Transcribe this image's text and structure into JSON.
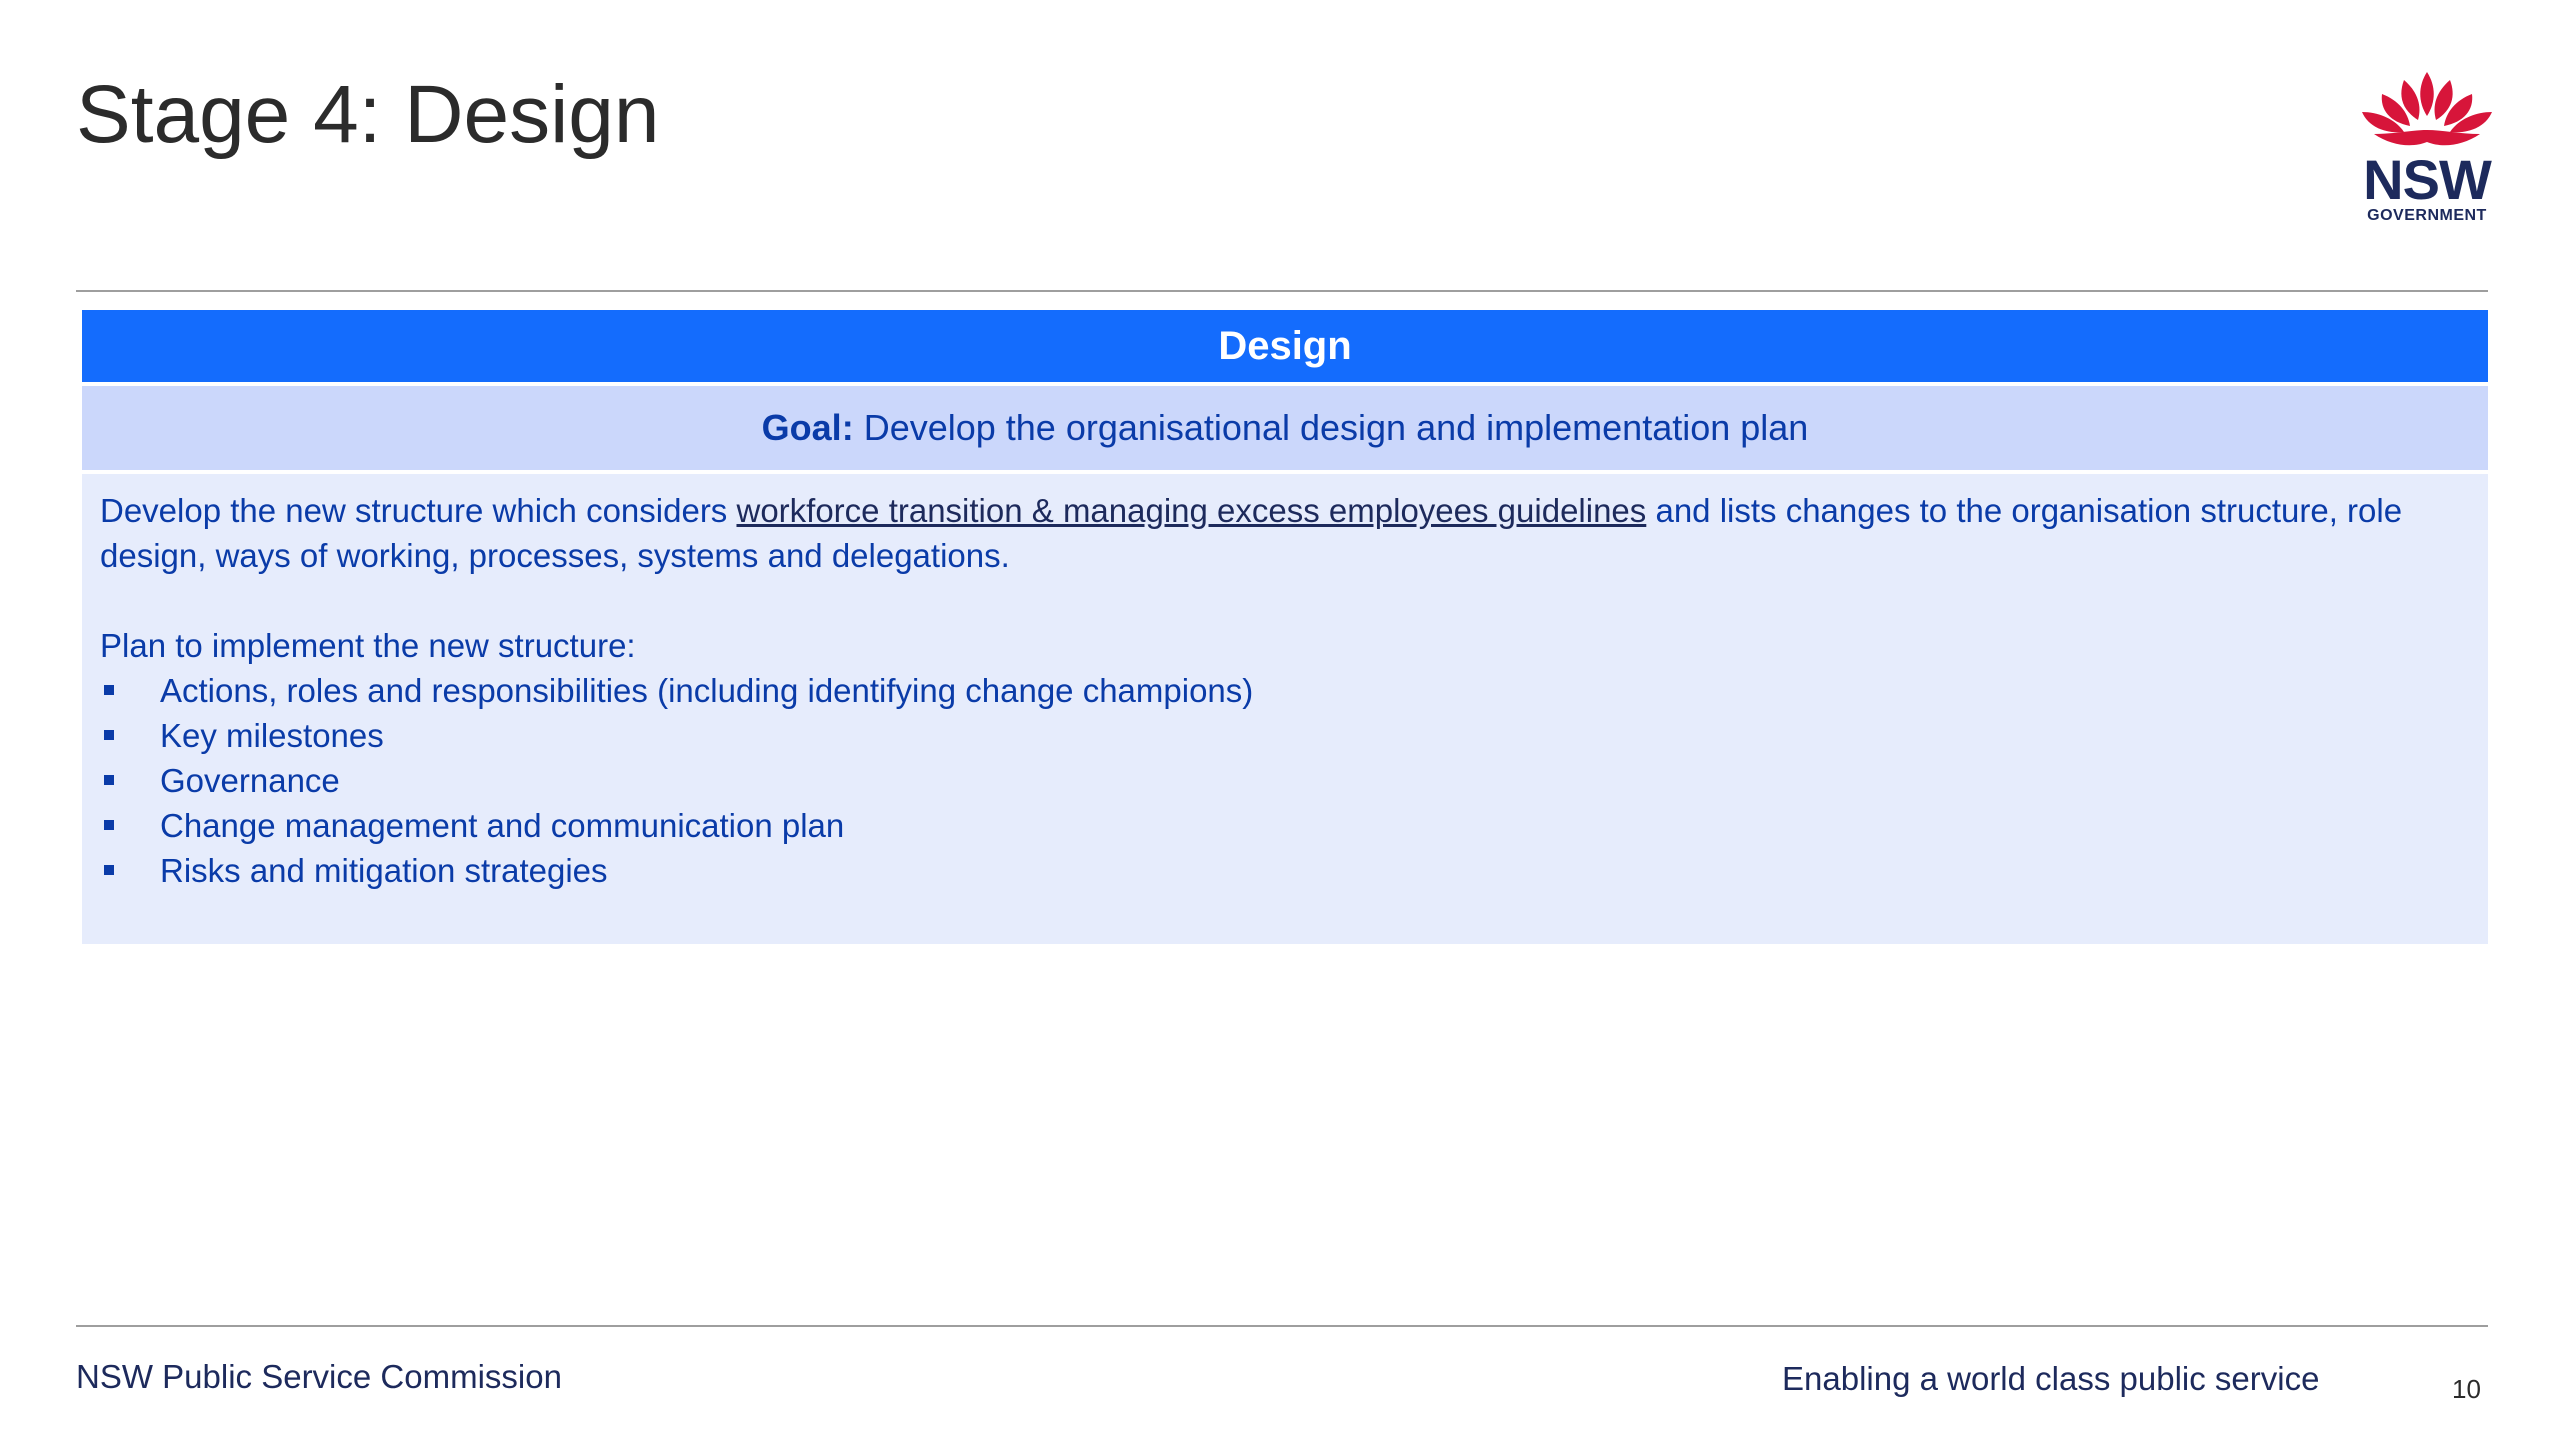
{
  "slide": {
    "title": "Stage 4: Design",
    "logo": {
      "icon": "waratah-flower-icon",
      "name": "NSW",
      "subtitle": "GOVERNMENT",
      "flower_color": "#d7153a"
    },
    "panel": {
      "header": "Design",
      "goal_label": "Goal:",
      "goal_text": " Develop the organisational design and implementation plan",
      "intro_before": "Develop the new structure which considers ",
      "intro_link": "workforce transition & managing excess employees guidelines",
      "intro_after": " and lists changes to the organisation structure, role design, ways of working, processes, systems and delegations.",
      "plan_heading": "Plan to implement the new structure:",
      "bullets": [
        "Actions, roles and responsibilities (including identifying change champions)",
        "Key milestones",
        "Governance",
        "Change management and communication plan",
        "Risks and mitigation strategies"
      ]
    },
    "footer": {
      "left": "NSW Public Service Commission",
      "right": "Enabling a world class public service",
      "page_number": "10"
    },
    "colors": {
      "header_blue": "#146cfd",
      "goal_bg": "#cbd7fb",
      "body_bg": "#e6ecfc",
      "text_blue": "#0a3ba8",
      "navy": "#1d2a5c"
    }
  }
}
